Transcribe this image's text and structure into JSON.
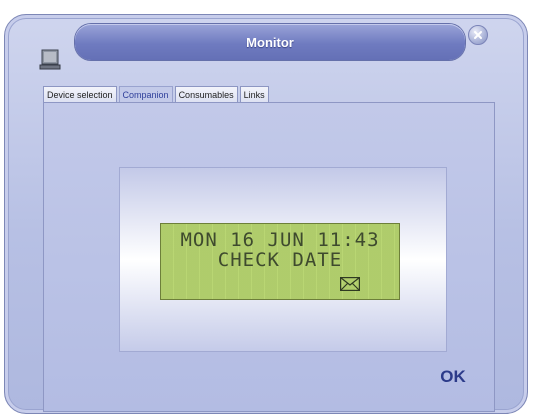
{
  "window": {
    "title": "Monitor"
  },
  "icons": {
    "app": "monitor-computer-icon",
    "close": "close-icon",
    "message": "envelope-icon"
  },
  "tabs": [
    {
      "label": "Device selection",
      "active": false
    },
    {
      "label": "Companion",
      "active": true
    },
    {
      "label": "Consumables",
      "active": false
    },
    {
      "label": "Links",
      "active": false
    }
  ],
  "lcd": {
    "line1": "MON 16 JUN 11:43",
    "line2": "CHECK DATE"
  },
  "buttons": {
    "ok_label": "OK"
  },
  "colors": {
    "title_bar": "#6f7bc0",
    "window_bg": "#b7c0e4",
    "lcd_bg": "#b9d673",
    "lcd_text": "#3e4a2e",
    "ok_text": "#2c3b8a",
    "active_tab_text": "#2f3f9a"
  }
}
